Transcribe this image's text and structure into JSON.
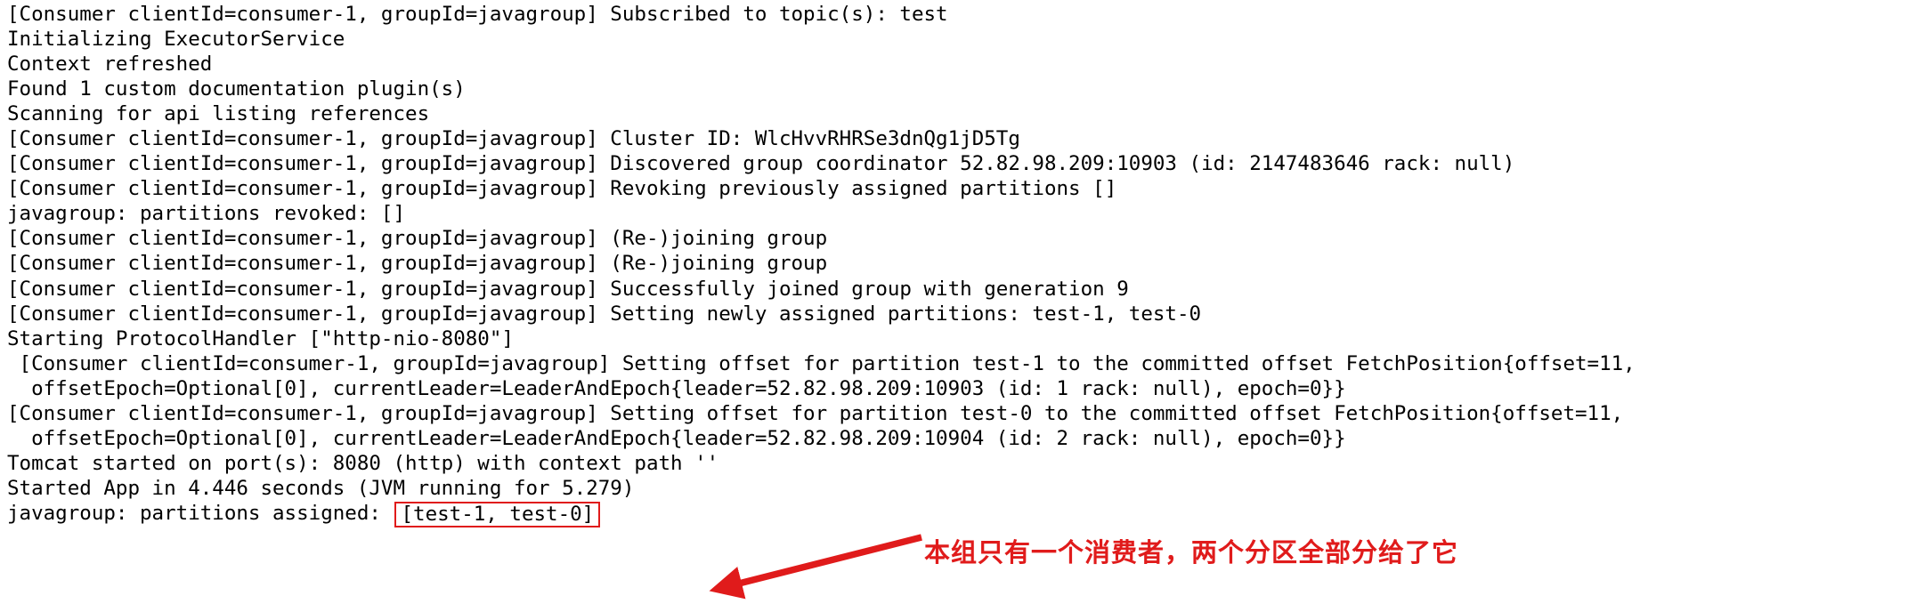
{
  "console": {
    "background_color": "#ffffff",
    "text_color": "#000000",
    "accent_color": "#e01b1b",
    "lines": [
      {
        "id": "line-1",
        "text": "[Consumer clientId=consumer-1, groupId=javagroup] Subscribed to topic(s): test"
      },
      {
        "id": "line-2",
        "text": "Initializing ExecutorService"
      },
      {
        "id": "line-3",
        "text": "Context refreshed"
      },
      {
        "id": "line-4",
        "text": "Found 1 custom documentation plugin(s)"
      },
      {
        "id": "line-5",
        "text": "Scanning for api listing references"
      },
      {
        "id": "line-6",
        "text": "[Consumer clientId=consumer-1, groupId=javagroup] Cluster ID: WlcHvvRHRSe3dnQg1jD5Tg"
      },
      {
        "id": "line-7",
        "text": "[Consumer clientId=consumer-1, groupId=javagroup] Discovered group coordinator 52.82.98.209:10903 (id: 2147483646 rack: null)"
      },
      {
        "id": "line-8",
        "text": "[Consumer clientId=consumer-1, groupId=javagroup] Revoking previously assigned partitions []"
      },
      {
        "id": "line-9",
        "text": "javagroup: partitions revoked: []"
      },
      {
        "id": "line-10",
        "text": "[Consumer clientId=consumer-1, groupId=javagroup] (Re-)joining group"
      },
      {
        "id": "line-11",
        "text": "[Consumer clientId=consumer-1, groupId=javagroup] (Re-)joining group"
      },
      {
        "id": "line-12",
        "text": "[Consumer clientId=consumer-1, groupId=javagroup] Successfully joined group with generation 9"
      },
      {
        "id": "line-13",
        "text": "[Consumer clientId=consumer-1, groupId=javagroup] Setting newly assigned partitions: test-1, test-0"
      },
      {
        "id": "line-14",
        "text": "Starting ProtocolHandler [\"http-nio-8080\"]"
      },
      {
        "id": "line-15",
        "text": " [Consumer clientId=consumer-1, groupId=javagroup] Setting offset for partition test-1 to the committed offset FetchPosition{offset=11,"
      },
      {
        "id": "line-16",
        "text": "  offsetEpoch=Optional[0], currentLeader=LeaderAndEpoch{leader=52.82.98.209:10903 (id: 1 rack: null), epoch=0}}"
      },
      {
        "id": "line-17",
        "text": "[Consumer clientId=consumer-1, groupId=javagroup] Setting offset for partition test-0 to the committed offset FetchPosition{offset=11,"
      },
      {
        "id": "line-18",
        "text": "  offsetEpoch=Optional[0], currentLeader=LeaderAndEpoch{leader=52.82.98.209:10904 (id: 2 rack: null), epoch=0}}"
      },
      {
        "id": "line-19",
        "text": "Tomcat started on port(s): 8080 (http) with context path ''"
      },
      {
        "id": "line-20",
        "text": "Started App in 4.446 seconds (JVM running for 5.279)"
      }
    ],
    "final_line": {
      "id": "line-21",
      "prefix": "javagroup: partitions assigned: ",
      "highlighted": "[test-1, test-0]"
    }
  },
  "annotation": {
    "note_text": "本组只有一个消费者，两个分区全部分给了它",
    "arrow_name": "red-arrow",
    "color": "#e01b1b"
  }
}
